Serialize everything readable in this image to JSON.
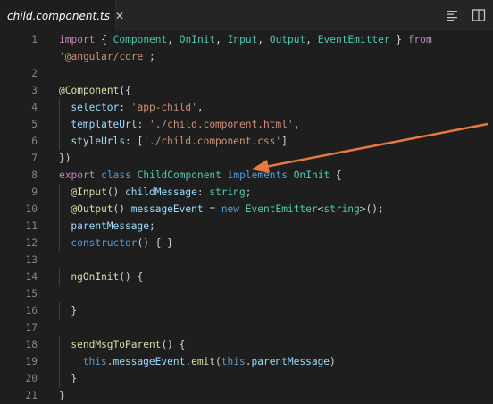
{
  "tab": {
    "label": "child.component.ts",
    "close_glyph": "✕",
    "icon": "angular-icon"
  },
  "actions": [
    "outline-icon",
    "split-editor-icon"
  ],
  "colors": {
    "keyword": "#c586c0",
    "storage": "#569cd6",
    "type": "#4ec9b0",
    "string": "#ce9178",
    "property": "#9cdcfe",
    "function": "#dcdcaa",
    "arrow": "#e8793a"
  },
  "lines": [
    {
      "n": "1",
      "indent": 0,
      "tokens": [
        [
          "k",
          "import"
        ],
        [
          "p",
          " { "
        ],
        [
          "t",
          "Component"
        ],
        [
          "p",
          ", "
        ],
        [
          "t",
          "OnInit"
        ],
        [
          "p",
          ", "
        ],
        [
          "t",
          "Input"
        ],
        [
          "p",
          ", "
        ],
        [
          "t",
          "Output"
        ],
        [
          "p",
          ", "
        ],
        [
          "t",
          "EventEmitter"
        ],
        [
          "p",
          " } "
        ],
        [
          "k",
          "from"
        ]
      ]
    },
    {
      "n": "",
      "indent": 0,
      "tokens": [
        [
          "s",
          "'@angular/core'"
        ],
        [
          "p",
          ";"
        ]
      ]
    },
    {
      "n": "2",
      "indent": 0,
      "tokens": []
    },
    {
      "n": "3",
      "indent": 0,
      "tokens": [
        [
          "f",
          "@Component"
        ],
        [
          "p",
          "({"
        ]
      ]
    },
    {
      "n": "4",
      "indent": 1,
      "tokens": [
        [
          "v",
          "selector"
        ],
        [
          "p",
          ": "
        ],
        [
          "s",
          "'app-child'"
        ],
        [
          "p",
          ","
        ]
      ]
    },
    {
      "n": "5",
      "indent": 1,
      "tokens": [
        [
          "v",
          "templateUrl"
        ],
        [
          "p",
          ": "
        ],
        [
          "s",
          "'./child.component.html'"
        ],
        [
          "p",
          ","
        ]
      ]
    },
    {
      "n": "6",
      "indent": 1,
      "tokens": [
        [
          "v",
          "styleUrls"
        ],
        [
          "p",
          ": ["
        ],
        [
          "s",
          "'./child.component.css'"
        ],
        [
          "p",
          "]"
        ]
      ]
    },
    {
      "n": "7",
      "indent": 0,
      "tokens": [
        [
          "p",
          "})"
        ]
      ]
    },
    {
      "n": "8",
      "indent": 0,
      "tokens": [
        [
          "k",
          "export"
        ],
        [
          "p",
          " "
        ],
        [
          "kb",
          "class"
        ],
        [
          "p",
          " "
        ],
        [
          "t",
          "ChildComponent"
        ],
        [
          "p",
          " "
        ],
        [
          "kb",
          "implements"
        ],
        [
          "p",
          " "
        ],
        [
          "t",
          "OnInit"
        ],
        [
          "p",
          " {"
        ]
      ]
    },
    {
      "n": "9",
      "indent": 1,
      "tokens": [
        [
          "f",
          "@Input"
        ],
        [
          "p",
          "() "
        ],
        [
          "v",
          "childMessage"
        ],
        [
          "p",
          ": "
        ],
        [
          "t",
          "string"
        ],
        [
          "p",
          ";"
        ]
      ]
    },
    {
      "n": "10",
      "indent": 1,
      "tokens": [
        [
          "f",
          "@Output"
        ],
        [
          "p",
          "() "
        ],
        [
          "v",
          "messageEvent"
        ],
        [
          "p",
          " = "
        ],
        [
          "kb",
          "new"
        ],
        [
          "p",
          " "
        ],
        [
          "t",
          "EventEmitter"
        ],
        [
          "p",
          "<"
        ],
        [
          "t",
          "string"
        ],
        [
          "p",
          ">();"
        ]
      ]
    },
    {
      "n": "11",
      "indent": 1,
      "tokens": [
        [
          "v",
          "parentMessage"
        ],
        [
          "p",
          ";"
        ]
      ]
    },
    {
      "n": "12",
      "indent": 1,
      "tokens": [
        [
          "kb",
          "constructor"
        ],
        [
          "p",
          "() { }"
        ]
      ]
    },
    {
      "n": "13",
      "indent": 0,
      "tokens": []
    },
    {
      "n": "14",
      "indent": 1,
      "tokens": [
        [
          "f",
          "ngOnInit"
        ],
        [
          "p",
          "() {"
        ]
      ]
    },
    {
      "n": "15",
      "indent": 0,
      "tokens": []
    },
    {
      "n": "16",
      "indent": 1,
      "tokens": [
        [
          "p",
          "}"
        ]
      ]
    },
    {
      "n": "17",
      "indent": 0,
      "tokens": []
    },
    {
      "n": "18",
      "indent": 1,
      "tokens": [
        [
          "f",
          "sendMsgToParent"
        ],
        [
          "p",
          "() {"
        ]
      ]
    },
    {
      "n": "19",
      "indent": 2,
      "tokens": [
        [
          "kb",
          "this"
        ],
        [
          "p",
          "."
        ],
        [
          "v",
          "messageEvent"
        ],
        [
          "p",
          "."
        ],
        [
          "f",
          "emit"
        ],
        [
          "p",
          "("
        ],
        [
          "kb",
          "this"
        ],
        [
          "p",
          "."
        ],
        [
          "v",
          "parentMessage"
        ],
        [
          "p",
          ")"
        ]
      ]
    },
    {
      "n": "20",
      "indent": 1,
      "tokens": [
        [
          "p",
          "}"
        ]
      ]
    },
    {
      "n": "21",
      "indent": 0,
      "tokens": [
        [
          "p",
          "}"
        ]
      ]
    }
  ]
}
